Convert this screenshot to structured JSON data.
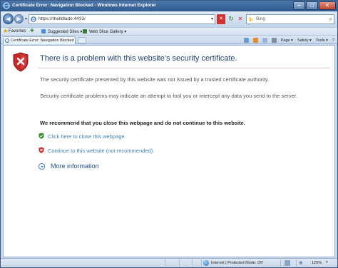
{
  "window": {
    "title": "Certificate Error: Navigation Blocked - Windows Internet Explorer",
    "minimize": "–",
    "maximize": "□",
    "close": "✕"
  },
  "address_bar": {
    "url": "https://rhelldlado:4433/",
    "dropdown": "▾",
    "cert_error_badge": "✕",
    "refresh": "↻",
    "stop": "✕",
    "search_placeholder": "Bing",
    "search_go": "⌕"
  },
  "favorites_bar": {
    "label": "Favorites",
    "items": [
      {
        "label": "Suggested Sites ▾"
      },
      {
        "label": "Web Slice Gallery ▾"
      }
    ]
  },
  "tab_bar": {
    "tab_label": "Certificate Error: Navigation Blocked",
    "commands": [
      {
        "label": "Page ▾"
      },
      {
        "label": "Safety ▾"
      },
      {
        "label": "Tools ▾"
      },
      {
        "label": "?"
      }
    ]
  },
  "content": {
    "headline": "There is a problem with this website's security certificate.",
    "paragraph1": "The security certificate presented by this website was not issued by a trusted certificate authority.",
    "paragraph2": "Security certificate problems may indicate an attempt to fool you or intercept any data you send to the server.",
    "recommendation": "We recommend that you close this webpage and do not continue to this website.",
    "close_link": "Click here to close this webpage.",
    "continue_link": "Continue to this website (not recommended).",
    "more_info": "More information"
  },
  "status_bar": {
    "zone_text": "Internet | Protected Mode: Off",
    "zoom": "125%"
  },
  "colors": {
    "headline": "#1f3f6f",
    "link": "#3f7fb8",
    "shield_red": "#c62828",
    "shield_green": "#2e8b2e"
  }
}
